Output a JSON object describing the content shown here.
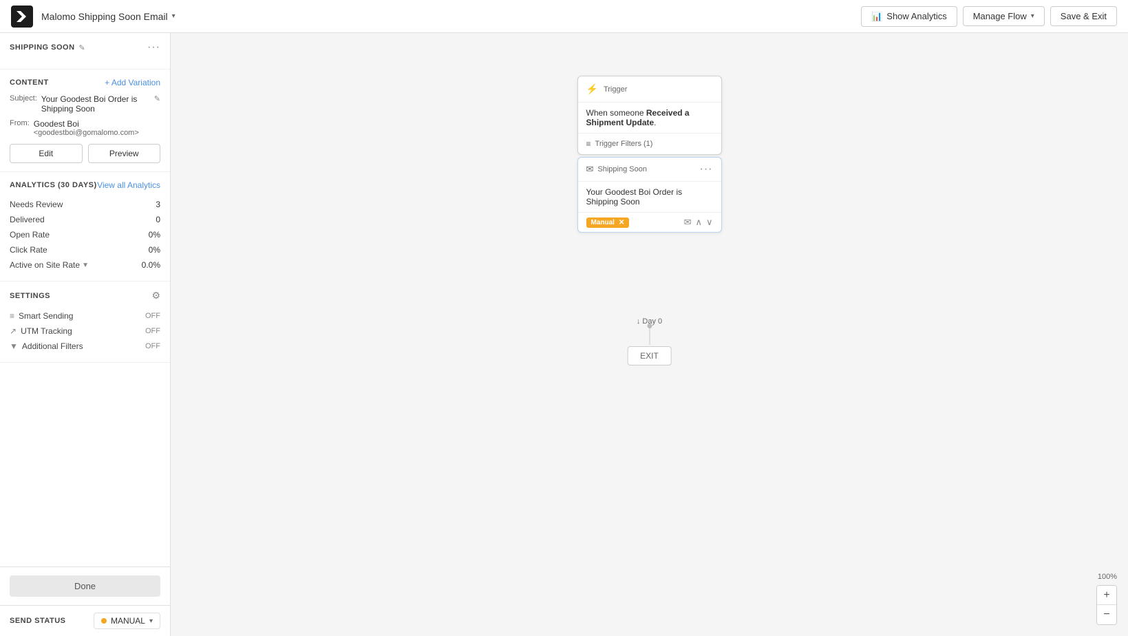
{
  "topNav": {
    "logoAlt": "Klaviyo",
    "flowName": "Malomo Shipping Soon Email",
    "showAnalyticsLabel": "Show Analytics",
    "manageFlowLabel": "Manage Flow",
    "saveExitLabel": "Save & Exit"
  },
  "sidebar": {
    "shippingSoon": {
      "title": "SHIPPING SOON"
    },
    "content": {
      "title": "CONTENT",
      "addVariationLabel": "+ Add Variation",
      "subjectLabel": "Subject:",
      "subjectValue": "Your Goodest Boi Order is Shipping Soon",
      "fromLabel": "From:",
      "fromName": "Goodest Boi",
      "fromEmail": "<goodestboi@gomalomo.com>",
      "editLabel": "Edit",
      "previewLabel": "Preview"
    },
    "analytics": {
      "title": "ANALYTICS (30 DAYS)",
      "viewAllLabel": "View all Analytics",
      "rows": [
        {
          "label": "Needs Review",
          "value": "3"
        },
        {
          "label": "Delivered",
          "value": "0"
        },
        {
          "label": "Open Rate",
          "value": "0%"
        },
        {
          "label": "Click Rate",
          "value": "0%"
        },
        {
          "label": "Active on Site Rate",
          "value": "0.0%"
        }
      ]
    },
    "settings": {
      "title": "SETTINGS",
      "rows": [
        {
          "icon": "≡",
          "label": "Smart Sending",
          "value": "OFF"
        },
        {
          "icon": "↗",
          "label": "UTM Tracking",
          "value": "OFF"
        },
        {
          "icon": "▼",
          "label": "Additional Filters",
          "value": "OFF"
        }
      ]
    },
    "doneLabel": "Done",
    "sendStatus": {
      "label": "SEND STATUS",
      "value": "MANUAL"
    }
  },
  "canvas": {
    "trigger": {
      "label": "Trigger",
      "body": "When someone",
      "boldText": "Received a Shipment Update",
      "period": ".",
      "filterLabel": "Trigger Filters (1)"
    },
    "emailNode": {
      "type": "Shipping Soon",
      "subject": "Your Goodest Boi Order is Shipping Soon",
      "statusBadge": "Manual",
      "dayLabel": "Day 0"
    },
    "exitLabel": "EXIT",
    "zoomPercent": "100%",
    "zoomIn": "+",
    "zoomOut": "−"
  }
}
